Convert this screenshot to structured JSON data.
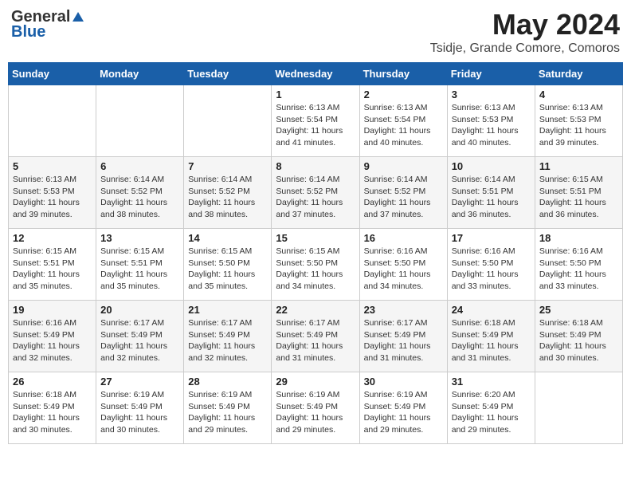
{
  "header": {
    "logo_general": "General",
    "logo_blue": "Blue",
    "month": "May 2024",
    "location": "Tsidje, Grande Comore, Comoros"
  },
  "days_of_week": [
    "Sunday",
    "Monday",
    "Tuesday",
    "Wednesday",
    "Thursday",
    "Friday",
    "Saturday"
  ],
  "weeks": [
    [
      {
        "day": "",
        "info": ""
      },
      {
        "day": "",
        "info": ""
      },
      {
        "day": "",
        "info": ""
      },
      {
        "day": "1",
        "info": "Sunrise: 6:13 AM\nSunset: 5:54 PM\nDaylight: 11 hours\nand 41 minutes."
      },
      {
        "day": "2",
        "info": "Sunrise: 6:13 AM\nSunset: 5:54 PM\nDaylight: 11 hours\nand 40 minutes."
      },
      {
        "day": "3",
        "info": "Sunrise: 6:13 AM\nSunset: 5:53 PM\nDaylight: 11 hours\nand 40 minutes."
      },
      {
        "day": "4",
        "info": "Sunrise: 6:13 AM\nSunset: 5:53 PM\nDaylight: 11 hours\nand 39 minutes."
      }
    ],
    [
      {
        "day": "5",
        "info": "Sunrise: 6:13 AM\nSunset: 5:53 PM\nDaylight: 11 hours\nand 39 minutes."
      },
      {
        "day": "6",
        "info": "Sunrise: 6:14 AM\nSunset: 5:52 PM\nDaylight: 11 hours\nand 38 minutes."
      },
      {
        "day": "7",
        "info": "Sunrise: 6:14 AM\nSunset: 5:52 PM\nDaylight: 11 hours\nand 38 minutes."
      },
      {
        "day": "8",
        "info": "Sunrise: 6:14 AM\nSunset: 5:52 PM\nDaylight: 11 hours\nand 37 minutes."
      },
      {
        "day": "9",
        "info": "Sunrise: 6:14 AM\nSunset: 5:52 PM\nDaylight: 11 hours\nand 37 minutes."
      },
      {
        "day": "10",
        "info": "Sunrise: 6:14 AM\nSunset: 5:51 PM\nDaylight: 11 hours\nand 36 minutes."
      },
      {
        "day": "11",
        "info": "Sunrise: 6:15 AM\nSunset: 5:51 PM\nDaylight: 11 hours\nand 36 minutes."
      }
    ],
    [
      {
        "day": "12",
        "info": "Sunrise: 6:15 AM\nSunset: 5:51 PM\nDaylight: 11 hours\nand 35 minutes."
      },
      {
        "day": "13",
        "info": "Sunrise: 6:15 AM\nSunset: 5:51 PM\nDaylight: 11 hours\nand 35 minutes."
      },
      {
        "day": "14",
        "info": "Sunrise: 6:15 AM\nSunset: 5:50 PM\nDaylight: 11 hours\nand 35 minutes."
      },
      {
        "day": "15",
        "info": "Sunrise: 6:15 AM\nSunset: 5:50 PM\nDaylight: 11 hours\nand 34 minutes."
      },
      {
        "day": "16",
        "info": "Sunrise: 6:16 AM\nSunset: 5:50 PM\nDaylight: 11 hours\nand 34 minutes."
      },
      {
        "day": "17",
        "info": "Sunrise: 6:16 AM\nSunset: 5:50 PM\nDaylight: 11 hours\nand 33 minutes."
      },
      {
        "day": "18",
        "info": "Sunrise: 6:16 AM\nSunset: 5:50 PM\nDaylight: 11 hours\nand 33 minutes."
      }
    ],
    [
      {
        "day": "19",
        "info": "Sunrise: 6:16 AM\nSunset: 5:49 PM\nDaylight: 11 hours\nand 32 minutes."
      },
      {
        "day": "20",
        "info": "Sunrise: 6:17 AM\nSunset: 5:49 PM\nDaylight: 11 hours\nand 32 minutes."
      },
      {
        "day": "21",
        "info": "Sunrise: 6:17 AM\nSunset: 5:49 PM\nDaylight: 11 hours\nand 32 minutes."
      },
      {
        "day": "22",
        "info": "Sunrise: 6:17 AM\nSunset: 5:49 PM\nDaylight: 11 hours\nand 31 minutes."
      },
      {
        "day": "23",
        "info": "Sunrise: 6:17 AM\nSunset: 5:49 PM\nDaylight: 11 hours\nand 31 minutes."
      },
      {
        "day": "24",
        "info": "Sunrise: 6:18 AM\nSunset: 5:49 PM\nDaylight: 11 hours\nand 31 minutes."
      },
      {
        "day": "25",
        "info": "Sunrise: 6:18 AM\nSunset: 5:49 PM\nDaylight: 11 hours\nand 30 minutes."
      }
    ],
    [
      {
        "day": "26",
        "info": "Sunrise: 6:18 AM\nSunset: 5:49 PM\nDaylight: 11 hours\nand 30 minutes."
      },
      {
        "day": "27",
        "info": "Sunrise: 6:19 AM\nSunset: 5:49 PM\nDaylight: 11 hours\nand 30 minutes."
      },
      {
        "day": "28",
        "info": "Sunrise: 6:19 AM\nSunset: 5:49 PM\nDaylight: 11 hours\nand 29 minutes."
      },
      {
        "day": "29",
        "info": "Sunrise: 6:19 AM\nSunset: 5:49 PM\nDaylight: 11 hours\nand 29 minutes."
      },
      {
        "day": "30",
        "info": "Sunrise: 6:19 AM\nSunset: 5:49 PM\nDaylight: 11 hours\nand 29 minutes."
      },
      {
        "day": "31",
        "info": "Sunrise: 6:20 AM\nSunset: 5:49 PM\nDaylight: 11 hours\nand 29 minutes."
      },
      {
        "day": "",
        "info": ""
      }
    ]
  ]
}
